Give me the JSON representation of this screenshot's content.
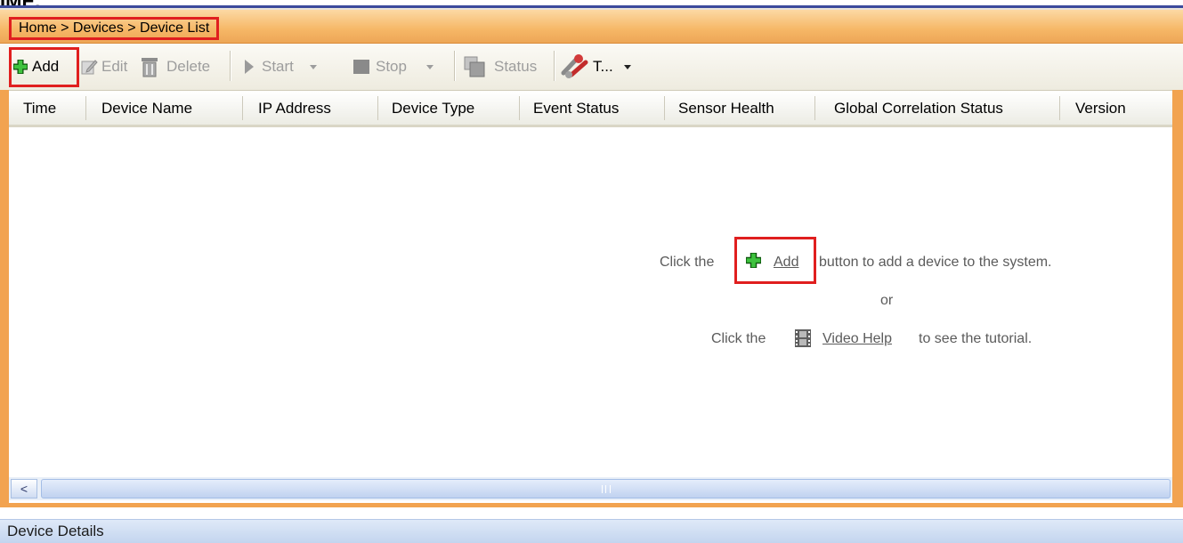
{
  "stray_caption": "IME.",
  "breadcrumb": "Home > Devices > Device List",
  "toolbar": {
    "add": "Add",
    "edit": "Edit",
    "delete": "Delete",
    "start": "Start",
    "stop": "Stop",
    "status": "Status",
    "tools": "T..."
  },
  "columns": [
    "Time",
    "Device Name",
    "IP Address",
    "Device Type",
    "Event Status",
    "Sensor Health",
    "Global Correlation Status",
    "Version"
  ],
  "empty_state": {
    "line1_prefix": "Click the",
    "line1_link": "Add",
    "line1_suffix": "button to add a device to the system.",
    "or": "or",
    "line3_prefix": "Click the",
    "line3_link": "Video Help",
    "line3_suffix": "to see the tutorial."
  },
  "scrollbar": {
    "left_arrow": "<"
  },
  "bottom_panel": "Device Details",
  "colors": {
    "highlight_red": "#e01f1f",
    "orange": "#f2a350",
    "add_green": "#1f8f1f"
  }
}
